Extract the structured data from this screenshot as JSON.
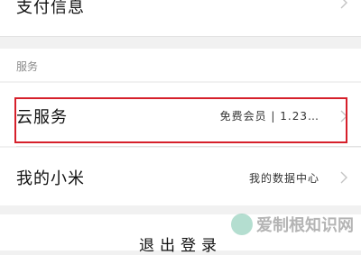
{
  "colors": {
    "background": "#f1f1f1",
    "row_bg": "#ffffff",
    "highlight": "#d6202b",
    "chevron": "#c4c4c4"
  },
  "payment": {
    "title": "支付信息",
    "icon": "chevron-right-icon"
  },
  "services_section": {
    "header": "服务"
  },
  "cloud": {
    "title": "云服务",
    "value": "免费会员 | 1.23…",
    "icon": "chevron-right-icon"
  },
  "xiaomi": {
    "title": "我的小米",
    "value": "我的数据中心",
    "icon": "chevron-right-icon"
  },
  "logout": {
    "label": "退出登录"
  },
  "watermark": {
    "text": "爱制根知识网"
  }
}
